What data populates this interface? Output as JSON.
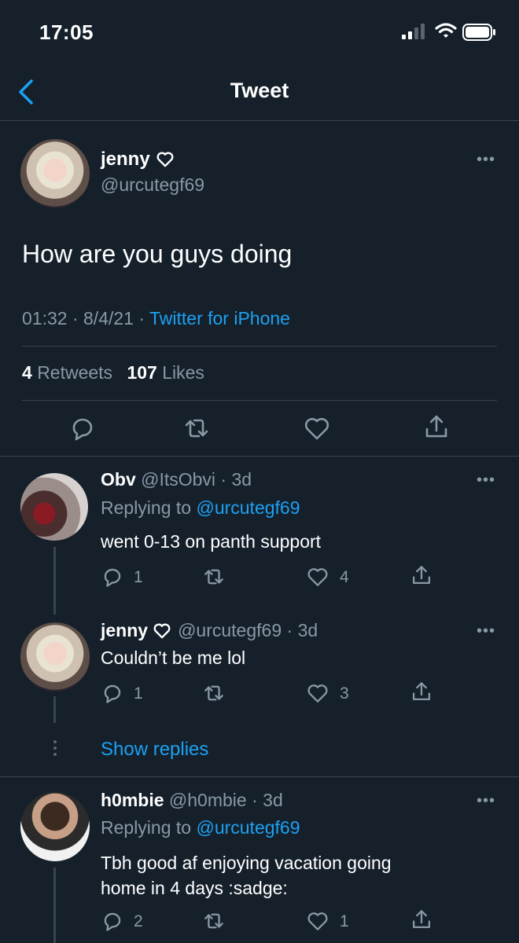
{
  "status_bar": {
    "time": "17:05"
  },
  "nav": {
    "title": "Tweet"
  },
  "main_tweet": {
    "display_name": "jenny",
    "handle": "@urcutegf69",
    "text": "How are you guys doing",
    "time": "01:32",
    "date": "8/4/21",
    "source": "Twitter for iPhone",
    "retweets_count": "4",
    "retweets_label": "Retweets",
    "likes_count": "107",
    "likes_label": "Likes"
  },
  "replies": [
    {
      "display_name": "Obv",
      "handle": "@ItsObvi",
      "age": "3d",
      "replying_prefix": "Replying to",
      "replying_to": "@urcutegf69",
      "text": "went 0-13 on panth support",
      "reply_count": "1",
      "like_count": "4"
    },
    {
      "display_name": "jenny",
      "handle": "@urcutegf69",
      "age": "3d",
      "text": "Couldn’t be me lol",
      "reply_count": "1",
      "like_count": "3"
    },
    {
      "display_name": "h0mbie",
      "handle": "@h0mbie",
      "age": "3d",
      "replying_prefix": "Replying to",
      "replying_to": "@urcutegf69",
      "text_line1": "Tbh good af enjoying vacation going",
      "text_line2": "home in 4 days :sadge:",
      "reply_count": "2",
      "like_count": "1"
    }
  ],
  "show_replies": "Show replies",
  "colors": {
    "background": "#15202b",
    "accent": "#1da1f2",
    "muted": "#8899a6",
    "divider": "#38444d"
  },
  "icons": [
    "back-chevron-icon",
    "verified-heart-icon",
    "more-icon",
    "reply-icon",
    "retweet-icon",
    "like-icon",
    "share-icon"
  ]
}
